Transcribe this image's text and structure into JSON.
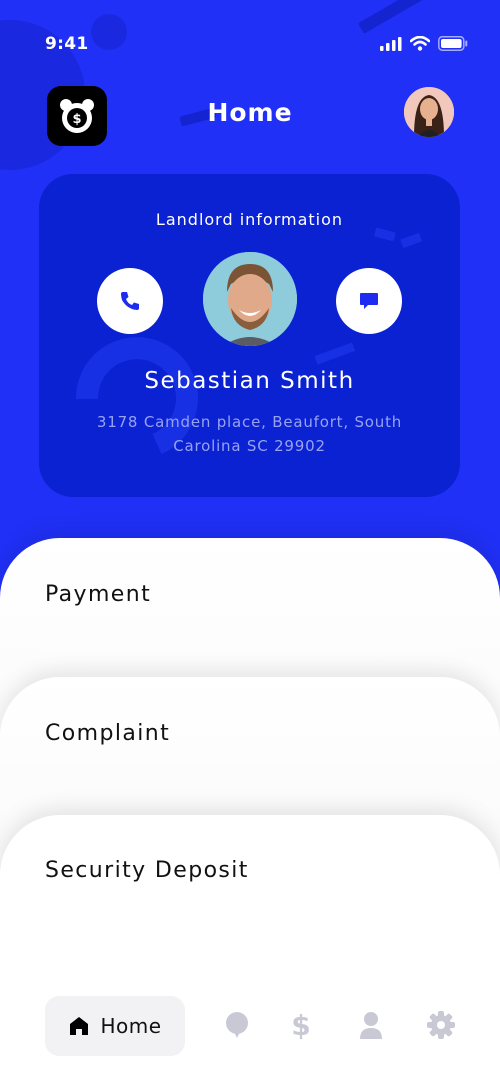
{
  "status_bar": {
    "time": "9:41",
    "icons": [
      "signal-icon",
      "wifi-icon",
      "battery-icon"
    ]
  },
  "header": {
    "title": "Home",
    "logo_icon": "alarm-clock-dollar-icon",
    "avatar": "profile-avatar"
  },
  "landlord_card": {
    "heading": "Landlord information",
    "name": "Sebastian Smith",
    "address": "3178 Camden place, Beaufort, South Carolina SC 29902",
    "call_icon": "phone-icon",
    "message_icon": "chat-icon"
  },
  "sections": [
    {
      "label": "Payment"
    },
    {
      "label": "Complaint"
    },
    {
      "label": "Security Deposit"
    }
  ],
  "bottom_nav": {
    "home_label": "Home",
    "items": [
      "home-icon",
      "complaint-bubble-icon",
      "dollar-icon",
      "user-icon",
      "settings-gear-icon"
    ]
  },
  "colors": {
    "background": "#2030f6",
    "card": "#0b22d2",
    "address_text": "#98a2f3",
    "inactive_nav": "#c9c9d6"
  }
}
